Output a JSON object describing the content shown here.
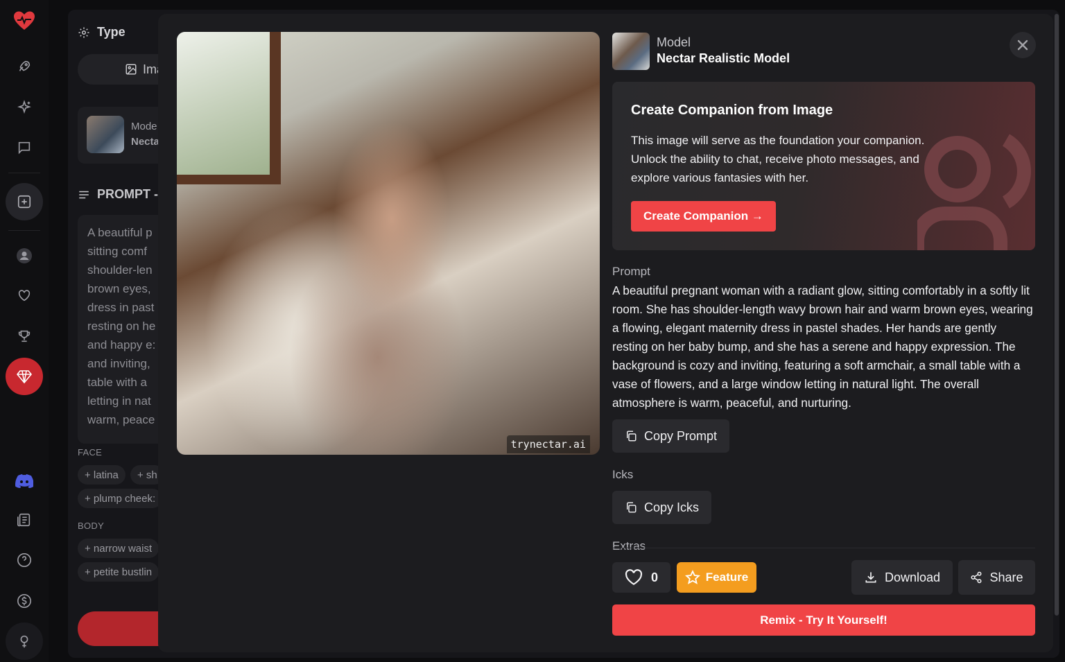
{
  "background": {
    "type_heading": "Type",
    "type_pill_label": "Ima",
    "model_label": "Mode",
    "model_name": "Necta",
    "prompt_heading": "PROMPT -",
    "prompt_lines": [
      "A beautiful p",
      "sitting comf",
      "shoulder-len",
      "brown eyes,",
      "dress in past",
      "resting on he",
      "and happy e:",
      "and inviting,",
      "table with a",
      "letting in nat",
      "warm, peace"
    ],
    "face_label": "FACE",
    "face_chips": [
      "+ latina",
      "+ sh",
      "+ plump cheek:"
    ],
    "body_label": "BODY",
    "body_chips": [
      "+ narrow waist",
      "+ petite bustlin"
    ]
  },
  "modal": {
    "watermark": "trynectar.ai",
    "close_icon": "close-icon",
    "model_label": "Model",
    "model_name": "Nectar Realistic Model",
    "promo": {
      "title": "Create Companion from Image",
      "body": "This image will serve as the foundation your companion. Unlock the ability to chat, receive photo messages, and explore various fantasies with her.",
      "cta": "Create Companion →"
    },
    "prompt_label": "Prompt",
    "prompt_text": "A beautiful pregnant woman with a radiant glow, sitting comfortably in a softly lit room. She has shoulder-length wavy brown hair and warm brown eyes, wearing a flowing, elegant maternity dress in pastel shades. Her hands are gently resting on her baby bump, and she has a serene and happy expression. The background is cozy and inviting, featuring a soft armchair, a small table with a vase of flowers, and a large window letting in natural light. The overall atmosphere is warm, peaceful, and nurturing.",
    "copy_prompt": "Copy Prompt",
    "icks_label": "Icks",
    "copy_icks": "Copy Icks",
    "extras_label": "Extras",
    "like_count": "0",
    "feature": "Feature",
    "download": "Download",
    "share": "Share",
    "remix": "Remix - Try It Yourself!"
  },
  "colors": {
    "accent_red": "#f04446",
    "feature_orange": "#f49d1f",
    "modal_bg": "#1c1c1f"
  }
}
